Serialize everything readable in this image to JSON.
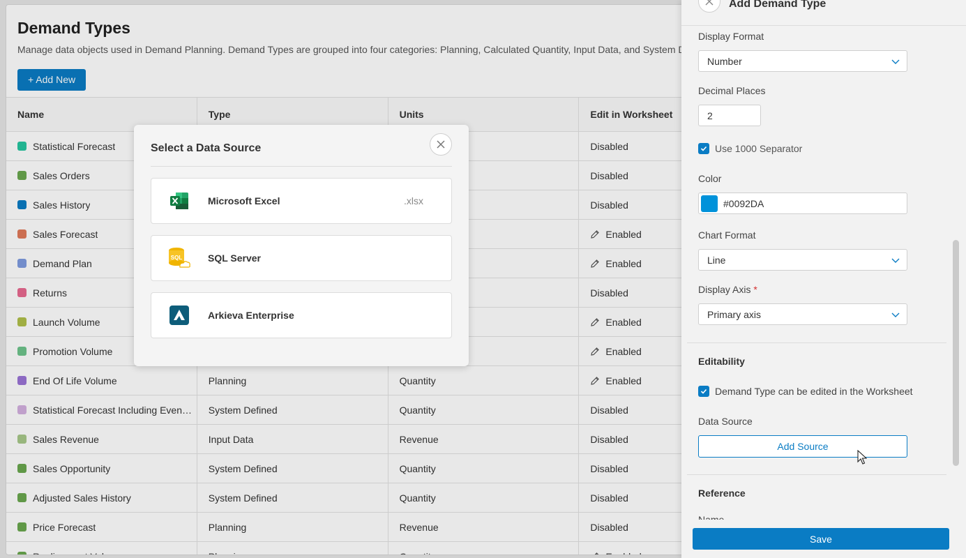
{
  "page": {
    "title": "Demand Types",
    "description": "Manage data objects used in Demand Planning. Demand Types are grouped into four categories: Planning, Calculated Quantity, Input Data, and System De",
    "add_new_label": "+ Add New"
  },
  "table": {
    "headers": [
      "Name",
      "Type",
      "Units",
      "Edit in Worksheet"
    ],
    "rows": [
      {
        "name": "Statistical Forecast",
        "color": "#26c6a0",
        "type": "",
        "units": "",
        "edit": "Disabled",
        "edit_icon": false
      },
      {
        "name": "Sales Orders",
        "color": "#6aa84f",
        "type": "",
        "units": "",
        "edit": "Disabled",
        "edit_icon": false
      },
      {
        "name": "Sales History",
        "color": "#0a7cc4",
        "type": "",
        "units": "",
        "edit": "Disabled",
        "edit_icon": false
      },
      {
        "name": "Sales Forecast",
        "color": "#e0795a",
        "type": "",
        "units": "",
        "edit": "Enabled",
        "edit_icon": true
      },
      {
        "name": "Demand Plan",
        "color": "#7f9be0",
        "type": "",
        "units": "",
        "edit": "Enabled",
        "edit_icon": true
      },
      {
        "name": "Returns",
        "color": "#e86a90",
        "type": "",
        "units": "",
        "edit": "Disabled",
        "edit_icon": false
      },
      {
        "name": "Launch Volume",
        "color": "#b0c04a",
        "type": "",
        "units": "",
        "edit": "Enabled",
        "edit_icon": true
      },
      {
        "name": "Promotion Volume",
        "color": "#6ec48c",
        "type": "",
        "units": "",
        "edit": "Enabled",
        "edit_icon": true
      },
      {
        "name": "End Of Life Volume",
        "color": "#9a74d6",
        "type": "Planning",
        "units": "Quantity",
        "edit": "Enabled",
        "edit_icon": true
      },
      {
        "name": "Statistical Forecast Including Even…",
        "color": "#d4b0e0",
        "type": "System Defined",
        "units": "Quantity",
        "edit": "Disabled",
        "edit_icon": false
      },
      {
        "name": "Sales Revenue",
        "color": "#a8c88a",
        "type": "Input Data",
        "units": "Revenue",
        "edit": "Disabled",
        "edit_icon": false
      },
      {
        "name": "Sales Opportunity",
        "color": "#6aa84f",
        "type": "System Defined",
        "units": "Quantity",
        "edit": "Disabled",
        "edit_icon": false
      },
      {
        "name": "Adjusted Sales History",
        "color": "#6aa84f",
        "type": "System Defined",
        "units": "Quantity",
        "edit": "Disabled",
        "edit_icon": false
      },
      {
        "name": "Price Forecast",
        "color": "#6aa84f",
        "type": "Planning",
        "units": "Revenue",
        "edit": "Disabled",
        "edit_icon": false
      },
      {
        "name": "Realignment Volume",
        "color": "#6aa84f",
        "type": "Planning",
        "units": "Quantity",
        "edit": "Enabled",
        "edit_icon": true
      }
    ]
  },
  "modal": {
    "title": "Select a Data Source",
    "sources": [
      {
        "label": "Microsoft Excel",
        "ext": ".xlsx",
        "icon": "excel-icon"
      },
      {
        "label": "SQL Server",
        "ext": "",
        "icon": "sql-server-icon"
      },
      {
        "label": "Arkieva Enterprise",
        "ext": "",
        "icon": "arkieva-icon"
      }
    ]
  },
  "panel": {
    "title": "Add Demand Type",
    "display_format_label": "Display Format",
    "display_format_value": "Number",
    "decimal_places_label": "Decimal Places",
    "decimal_places_value": "2",
    "separator_label": "Use 1000 Separator",
    "color_label": "Color",
    "color_value": "#0092DA",
    "chart_format_label": "Chart Format",
    "chart_format_value": "Line",
    "display_axis_label": "Display Axis",
    "display_axis_required": "*",
    "display_axis_value": "Primary axis",
    "editability_title": "Editability",
    "editable_label": "Demand Type can be edited in the Worksheet",
    "data_source_label": "Data Source",
    "add_source_label": "Add Source",
    "reference_title": "Reference",
    "reference_name_label": "Name",
    "save_label": "Save"
  }
}
